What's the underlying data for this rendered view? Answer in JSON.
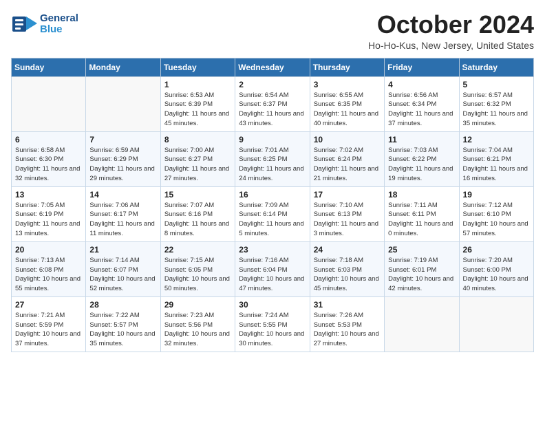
{
  "header": {
    "logo_general": "General",
    "logo_blue": "Blue",
    "month": "October 2024",
    "location": "Ho-Ho-Kus, New Jersey, United States"
  },
  "days_of_week": [
    "Sunday",
    "Monday",
    "Tuesday",
    "Wednesday",
    "Thursday",
    "Friday",
    "Saturday"
  ],
  "weeks": [
    [
      {
        "day": "",
        "info": ""
      },
      {
        "day": "",
        "info": ""
      },
      {
        "day": "1",
        "info": "Sunrise: 6:53 AM\nSunset: 6:39 PM\nDaylight: 11 hours and 45 minutes."
      },
      {
        "day": "2",
        "info": "Sunrise: 6:54 AM\nSunset: 6:37 PM\nDaylight: 11 hours and 43 minutes."
      },
      {
        "day": "3",
        "info": "Sunrise: 6:55 AM\nSunset: 6:35 PM\nDaylight: 11 hours and 40 minutes."
      },
      {
        "day": "4",
        "info": "Sunrise: 6:56 AM\nSunset: 6:34 PM\nDaylight: 11 hours and 37 minutes."
      },
      {
        "day": "5",
        "info": "Sunrise: 6:57 AM\nSunset: 6:32 PM\nDaylight: 11 hours and 35 minutes."
      }
    ],
    [
      {
        "day": "6",
        "info": "Sunrise: 6:58 AM\nSunset: 6:30 PM\nDaylight: 11 hours and 32 minutes."
      },
      {
        "day": "7",
        "info": "Sunrise: 6:59 AM\nSunset: 6:29 PM\nDaylight: 11 hours and 29 minutes."
      },
      {
        "day": "8",
        "info": "Sunrise: 7:00 AM\nSunset: 6:27 PM\nDaylight: 11 hours and 27 minutes."
      },
      {
        "day": "9",
        "info": "Sunrise: 7:01 AM\nSunset: 6:25 PM\nDaylight: 11 hours and 24 minutes."
      },
      {
        "day": "10",
        "info": "Sunrise: 7:02 AM\nSunset: 6:24 PM\nDaylight: 11 hours and 21 minutes."
      },
      {
        "day": "11",
        "info": "Sunrise: 7:03 AM\nSunset: 6:22 PM\nDaylight: 11 hours and 19 minutes."
      },
      {
        "day": "12",
        "info": "Sunrise: 7:04 AM\nSunset: 6:21 PM\nDaylight: 11 hours and 16 minutes."
      }
    ],
    [
      {
        "day": "13",
        "info": "Sunrise: 7:05 AM\nSunset: 6:19 PM\nDaylight: 11 hours and 13 minutes."
      },
      {
        "day": "14",
        "info": "Sunrise: 7:06 AM\nSunset: 6:17 PM\nDaylight: 11 hours and 11 minutes."
      },
      {
        "day": "15",
        "info": "Sunrise: 7:07 AM\nSunset: 6:16 PM\nDaylight: 11 hours and 8 minutes."
      },
      {
        "day": "16",
        "info": "Sunrise: 7:09 AM\nSunset: 6:14 PM\nDaylight: 11 hours and 5 minutes."
      },
      {
        "day": "17",
        "info": "Sunrise: 7:10 AM\nSunset: 6:13 PM\nDaylight: 11 hours and 3 minutes."
      },
      {
        "day": "18",
        "info": "Sunrise: 7:11 AM\nSunset: 6:11 PM\nDaylight: 11 hours and 0 minutes."
      },
      {
        "day": "19",
        "info": "Sunrise: 7:12 AM\nSunset: 6:10 PM\nDaylight: 10 hours and 57 minutes."
      }
    ],
    [
      {
        "day": "20",
        "info": "Sunrise: 7:13 AM\nSunset: 6:08 PM\nDaylight: 10 hours and 55 minutes."
      },
      {
        "day": "21",
        "info": "Sunrise: 7:14 AM\nSunset: 6:07 PM\nDaylight: 10 hours and 52 minutes."
      },
      {
        "day": "22",
        "info": "Sunrise: 7:15 AM\nSunset: 6:05 PM\nDaylight: 10 hours and 50 minutes."
      },
      {
        "day": "23",
        "info": "Sunrise: 7:16 AM\nSunset: 6:04 PM\nDaylight: 10 hours and 47 minutes."
      },
      {
        "day": "24",
        "info": "Sunrise: 7:18 AM\nSunset: 6:03 PM\nDaylight: 10 hours and 45 minutes."
      },
      {
        "day": "25",
        "info": "Sunrise: 7:19 AM\nSunset: 6:01 PM\nDaylight: 10 hours and 42 minutes."
      },
      {
        "day": "26",
        "info": "Sunrise: 7:20 AM\nSunset: 6:00 PM\nDaylight: 10 hours and 40 minutes."
      }
    ],
    [
      {
        "day": "27",
        "info": "Sunrise: 7:21 AM\nSunset: 5:59 PM\nDaylight: 10 hours and 37 minutes."
      },
      {
        "day": "28",
        "info": "Sunrise: 7:22 AM\nSunset: 5:57 PM\nDaylight: 10 hours and 35 minutes."
      },
      {
        "day": "29",
        "info": "Sunrise: 7:23 AM\nSunset: 5:56 PM\nDaylight: 10 hours and 32 minutes."
      },
      {
        "day": "30",
        "info": "Sunrise: 7:24 AM\nSunset: 5:55 PM\nDaylight: 10 hours and 30 minutes."
      },
      {
        "day": "31",
        "info": "Sunrise: 7:26 AM\nSunset: 5:53 PM\nDaylight: 10 hours and 27 minutes."
      },
      {
        "day": "",
        "info": ""
      },
      {
        "day": "",
        "info": ""
      }
    ]
  ]
}
